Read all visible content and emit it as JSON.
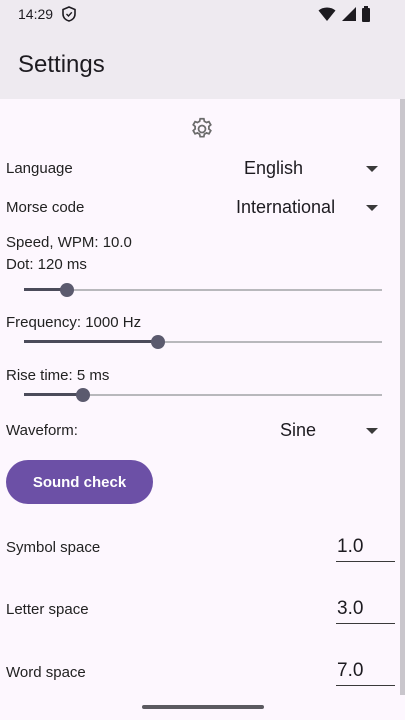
{
  "status": {
    "time": "14:29"
  },
  "appbar": {
    "title": "Settings"
  },
  "language": {
    "label": "Language",
    "value": "English"
  },
  "morse_code": {
    "label": "Morse code",
    "value": "International"
  },
  "speed": {
    "label": "Speed, WPM: 10.0",
    "dot_label": "Dot: 120 ms",
    "slider_fraction": 0.12
  },
  "frequency": {
    "label": "Frequency: 1000 Hz",
    "slider_fraction": 0.375
  },
  "rise_time": {
    "label": "Rise time: 5 ms",
    "slider_fraction": 0.165
  },
  "waveform": {
    "label": "Waveform:",
    "value": "Sine"
  },
  "sound_check": {
    "label": "Sound check"
  },
  "symbol_space": {
    "label": "Symbol space",
    "value": "1.0"
  },
  "letter_space": {
    "label": "Letter space",
    "value": "3.0"
  },
  "word_space": {
    "label": "Word space",
    "value": "7.0"
  },
  "colors": {
    "accent": "#6c50a6",
    "appbar": "#eeeaf0",
    "background": "#fdf7fe"
  }
}
